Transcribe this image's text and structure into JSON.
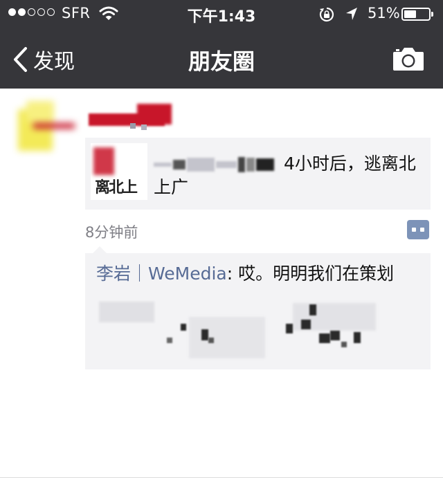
{
  "status_bar": {
    "carrier": "SFR",
    "time": "下午1:43",
    "battery_percent_label": "51%",
    "battery_level": 0.51,
    "signal_bars_filled": 2,
    "signal_bars_total": 5,
    "icons": [
      "wifi-icon",
      "rotation-lock-icon",
      "location-arrow-icon",
      "battery-icon"
    ]
  },
  "nav": {
    "back_label": "发现",
    "title": "朋友圈",
    "right_icon": "camera-icon"
  },
  "post": {
    "shared_article_title_visible": "4小时后，逃离北上广",
    "thumbnail_text": "离北上",
    "timestamp": "8分钟前",
    "comment": {
      "author": "李岩｜WeMedia",
      "text": ": 哎。明明我们在策划"
    }
  },
  "colors": {
    "bar_bg": "#36363a",
    "link_blue": "#576b95",
    "card_bg": "#f3f3f5",
    "timestamp_gray": "#7f7f86",
    "comment_button_bg": "#7d93b8"
  }
}
